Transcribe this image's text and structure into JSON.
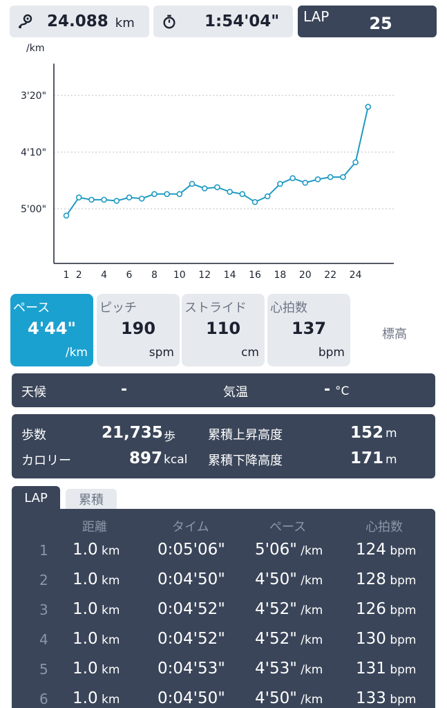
{
  "header": {
    "distance": "24.088",
    "distance_unit": "km",
    "time": "1:54'04\"",
    "lap_label": "LAP",
    "lap_value": "25"
  },
  "chart_data": {
    "type": "line",
    "ylabel": "/km",
    "y_ticks": [
      {
        "label": "3'20\"",
        "seconds": 200
      },
      {
        "label": "4'10\"",
        "seconds": 250
      },
      {
        "label": "5'00\"",
        "seconds": 300
      }
    ],
    "x_ticks": [
      "1",
      "2",
      "4",
      "6",
      "8",
      "10",
      "12",
      "14",
      "16",
      "18",
      "20",
      "22",
      "24"
    ],
    "x": [
      1,
      2,
      3,
      4,
      5,
      6,
      7,
      8,
      9,
      10,
      11,
      12,
      13,
      14,
      15,
      16,
      17,
      18,
      19,
      20,
      21,
      22,
      23,
      24,
      25
    ],
    "values_seconds": [
      306,
      290,
      292,
      292,
      293,
      290,
      291,
      287,
      287,
      287,
      278,
      282,
      281,
      285,
      287,
      294,
      289,
      278,
      273,
      277,
      274,
      272,
      272,
      259,
      210
    ],
    "invert_y": true,
    "grid": true,
    "color": "#1f9ac2"
  },
  "metrics": [
    {
      "label": "ペース",
      "value": "4'44\"",
      "unit": "/km",
      "active": true
    },
    {
      "label": "ピッチ",
      "value": "190",
      "unit": "spm",
      "active": false
    },
    {
      "label": "ストライド",
      "value": "110",
      "unit": "cm",
      "active": false
    },
    {
      "label": "心拍数",
      "value": "137",
      "unit": "bpm",
      "active": false
    },
    {
      "label": "標高",
      "value": "",
      "unit": "",
      "active": false
    }
  ],
  "weather": {
    "label": "天候",
    "value": "-",
    "temp_label": "気温",
    "temp_value": "-",
    "temp_unit": "°C"
  },
  "stats": {
    "steps_label": "歩数",
    "steps": "21,735",
    "steps_unit": "歩",
    "calorie_label": "カロリー",
    "calories": "897",
    "calorie_unit": "kcal",
    "ascent_label": "累積上昇高度",
    "ascent": "152",
    "ascent_unit": "m",
    "descent_label": "累積下降高度",
    "descent": "171",
    "descent_unit": "m"
  },
  "tabs": {
    "lap": "LAP",
    "cumulative": "累積"
  },
  "table": {
    "headers": [
      "距離",
      "タイム",
      "ペース",
      "心拍数"
    ],
    "rows": [
      {
        "n": "1",
        "dist": "1.0",
        "dist_unit": "km",
        "time": "0:05'06\"",
        "pace": "5'06\"",
        "pace_unit": "/km",
        "hr": "124",
        "hr_unit": "bpm"
      },
      {
        "n": "2",
        "dist": "1.0",
        "dist_unit": "km",
        "time": "0:04'50\"",
        "pace": "4'50\"",
        "pace_unit": "/km",
        "hr": "128",
        "hr_unit": "bpm"
      },
      {
        "n": "3",
        "dist": "1.0",
        "dist_unit": "km",
        "time": "0:04'52\"",
        "pace": "4'52\"",
        "pace_unit": "/km",
        "hr": "126",
        "hr_unit": "bpm"
      },
      {
        "n": "4",
        "dist": "1.0",
        "dist_unit": "km",
        "time": "0:04'52\"",
        "pace": "4'52\"",
        "pace_unit": "/km",
        "hr": "130",
        "hr_unit": "bpm"
      },
      {
        "n": "5",
        "dist": "1.0",
        "dist_unit": "km",
        "time": "0:04'53\"",
        "pace": "4'53\"",
        "pace_unit": "/km",
        "hr": "131",
        "hr_unit": "bpm"
      },
      {
        "n": "6",
        "dist": "1.0",
        "dist_unit": "km",
        "time": "0:04'50\"",
        "pace": "4'50\"",
        "pace_unit": "/km",
        "hr": "133",
        "hr_unit": "bpm"
      }
    ]
  }
}
